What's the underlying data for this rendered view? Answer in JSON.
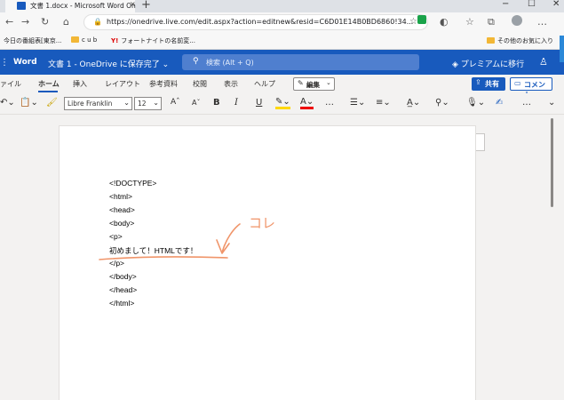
{
  "browser": {
    "tab_title": "文書 1.docx - Microsoft Word On",
    "tab_close": "×",
    "new_tab": "+",
    "url": "https://onedrive.live.com/edit.aspx?action=editnew&resid=C6D01E14B0BD6860!34...",
    "bookmarks": [
      {
        "label": "今日の番組表[東京..."
      },
      {
        "label": "c u b"
      },
      {
        "label": "フォートナイトの名前変..."
      },
      {
        "label": "その他のお気に入り"
      }
    ]
  },
  "word": {
    "app_name": "Word",
    "doc_title": "文書 1 - OneDrive に保存完了",
    "search_placeholder": "検索 (Alt + Q)",
    "premium": "プレミアムに移行",
    "ribbon_tabs": [
      "ァイル",
      "ホーム",
      "挿入",
      "レイアウト",
      "参考資料",
      "校閲",
      "表示",
      "ヘルプ"
    ],
    "edit_label": "編集",
    "share_label": "共有",
    "comment_label": "コメント",
    "font_name": "Libre Franklin",
    "font_size": "12"
  },
  "document": {
    "lines": [
      "<!DOCTYPE>",
      "<html>",
      "<head>",
      "<body>",
      "<p>",
      "初めまして！HTMLです！",
      "</p>",
      "</body>",
      "</head>",
      "</html>"
    ],
    "annotation": "コレ"
  },
  "colors": {
    "word_blue": "#185abd",
    "annotation_orange": "#f0956a"
  }
}
